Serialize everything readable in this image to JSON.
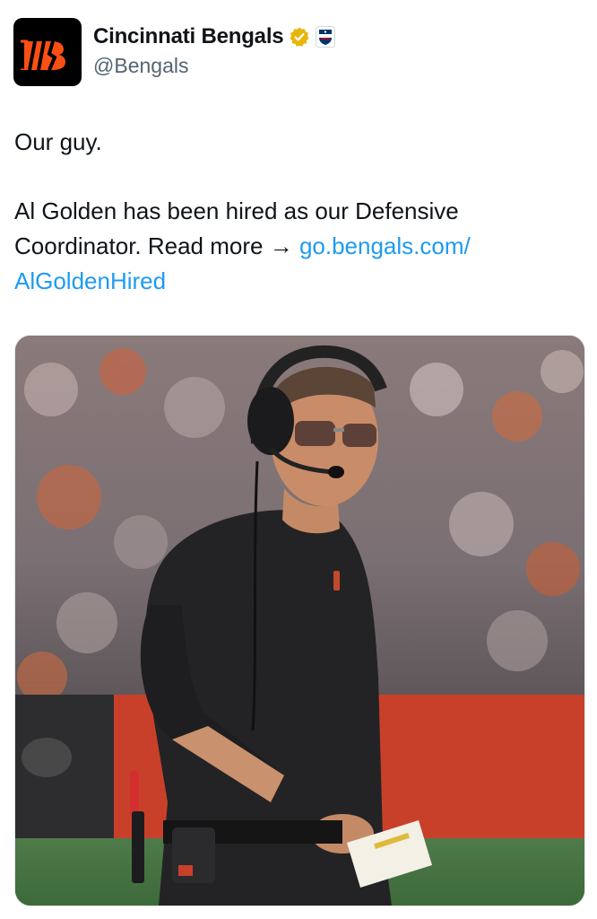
{
  "account": {
    "display_name": "Cincinnati Bengals",
    "handle": "@Bengals",
    "verified": true,
    "affiliate_badge": "nfl-shield-icon",
    "avatar_icon": "bengals-logo"
  },
  "tweet": {
    "line1": "Our guy.",
    "body_text": "Al Golden has been hired as our Defensive Coordinator. Read more → ",
    "link_text": "go.bengals.com/ AlGoldenHired"
  },
  "colors": {
    "link": "#1d9bf0",
    "verified_gold": "#e8b50a",
    "bengals_orange": "#fb4f14"
  }
}
